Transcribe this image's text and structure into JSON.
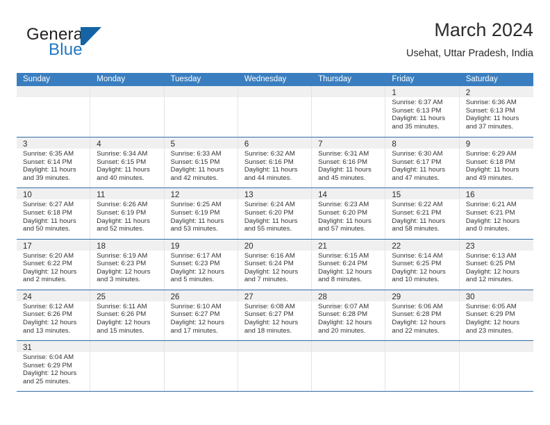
{
  "brand": {
    "name_part1": "General",
    "name_part2": "Blue",
    "mark_icon": "triangle-logo-icon",
    "color_primary": "#1464a5",
    "color_text": "#231f20"
  },
  "header": {
    "title": "March 2024",
    "subtitle": "Usehat, Uttar Pradesh, India"
  },
  "theme": {
    "header_blue": "#3a7ebf",
    "rule_blue": "#2f6ba5",
    "day_band_gray": "#f0f0f0"
  },
  "weekdays": [
    {
      "label": "Sunday"
    },
    {
      "label": "Monday"
    },
    {
      "label": "Tuesday"
    },
    {
      "label": "Wednesday"
    },
    {
      "label": "Thursday"
    },
    {
      "label": "Friday"
    },
    {
      "label": "Saturday"
    }
  ],
  "weeks": [
    {
      "days": [
        {
          "date": "",
          "empty": true,
          "lines": []
        },
        {
          "date": "",
          "empty": true,
          "lines": []
        },
        {
          "date": "",
          "empty": true,
          "lines": []
        },
        {
          "date": "",
          "empty": true,
          "lines": []
        },
        {
          "date": "",
          "empty": true,
          "lines": []
        },
        {
          "date": "1",
          "empty": false,
          "sunrise": "6:37 AM",
          "sunset": "6:13 PM",
          "daylight_hours": 11,
          "daylight_minutes": 35,
          "lines": [
            "Sunrise: 6:37 AM",
            "Sunset: 6:13 PM",
            "Daylight: 11 hours",
            "and 35 minutes."
          ]
        },
        {
          "date": "2",
          "empty": false,
          "sunrise": "6:36 AM",
          "sunset": "6:13 PM",
          "daylight_hours": 11,
          "daylight_minutes": 37,
          "lines": [
            "Sunrise: 6:36 AM",
            "Sunset: 6:13 PM",
            "Daylight: 11 hours",
            "and 37 minutes."
          ]
        }
      ]
    },
    {
      "days": [
        {
          "date": "3",
          "empty": false,
          "sunrise": "6:35 AM",
          "sunset": "6:14 PM",
          "daylight_hours": 11,
          "daylight_minutes": 39,
          "lines": [
            "Sunrise: 6:35 AM",
            "Sunset: 6:14 PM",
            "Daylight: 11 hours",
            "and 39 minutes."
          ]
        },
        {
          "date": "4",
          "empty": false,
          "sunrise": "6:34 AM",
          "sunset": "6:15 PM",
          "daylight_hours": 11,
          "daylight_minutes": 40,
          "lines": [
            "Sunrise: 6:34 AM",
            "Sunset: 6:15 PM",
            "Daylight: 11 hours",
            "and 40 minutes."
          ]
        },
        {
          "date": "5",
          "empty": false,
          "sunrise": "6:33 AM",
          "sunset": "6:15 PM",
          "daylight_hours": 11,
          "daylight_minutes": 42,
          "lines": [
            "Sunrise: 6:33 AM",
            "Sunset: 6:15 PM",
            "Daylight: 11 hours",
            "and 42 minutes."
          ]
        },
        {
          "date": "6",
          "empty": false,
          "sunrise": "6:32 AM",
          "sunset": "6:16 PM",
          "daylight_hours": 11,
          "daylight_minutes": 44,
          "lines": [
            "Sunrise: 6:32 AM",
            "Sunset: 6:16 PM",
            "Daylight: 11 hours",
            "and 44 minutes."
          ]
        },
        {
          "date": "7",
          "empty": false,
          "sunrise": "6:31 AM",
          "sunset": "6:16 PM",
          "daylight_hours": 11,
          "daylight_minutes": 45,
          "lines": [
            "Sunrise: 6:31 AM",
            "Sunset: 6:16 PM",
            "Daylight: 11 hours",
            "and 45 minutes."
          ]
        },
        {
          "date": "8",
          "empty": false,
          "sunrise": "6:30 AM",
          "sunset": "6:17 PM",
          "daylight_hours": 11,
          "daylight_minutes": 47,
          "lines": [
            "Sunrise: 6:30 AM",
            "Sunset: 6:17 PM",
            "Daylight: 11 hours",
            "and 47 minutes."
          ]
        },
        {
          "date": "9",
          "empty": false,
          "sunrise": "6:29 AM",
          "sunset": "6:18 PM",
          "daylight_hours": 11,
          "daylight_minutes": 49,
          "lines": [
            "Sunrise: 6:29 AM",
            "Sunset: 6:18 PM",
            "Daylight: 11 hours",
            "and 49 minutes."
          ]
        }
      ]
    },
    {
      "days": [
        {
          "date": "10",
          "empty": false,
          "sunrise": "6:27 AM",
          "sunset": "6:18 PM",
          "daylight_hours": 11,
          "daylight_minutes": 50,
          "lines": [
            "Sunrise: 6:27 AM",
            "Sunset: 6:18 PM",
            "Daylight: 11 hours",
            "and 50 minutes."
          ]
        },
        {
          "date": "11",
          "empty": false,
          "sunrise": "6:26 AM",
          "sunset": "6:19 PM",
          "daylight_hours": 11,
          "daylight_minutes": 52,
          "lines": [
            "Sunrise: 6:26 AM",
            "Sunset: 6:19 PM",
            "Daylight: 11 hours",
            "and 52 minutes."
          ]
        },
        {
          "date": "12",
          "empty": false,
          "sunrise": "6:25 AM",
          "sunset": "6:19 PM",
          "daylight_hours": 11,
          "daylight_minutes": 53,
          "lines": [
            "Sunrise: 6:25 AM",
            "Sunset: 6:19 PM",
            "Daylight: 11 hours",
            "and 53 minutes."
          ]
        },
        {
          "date": "13",
          "empty": false,
          "sunrise": "6:24 AM",
          "sunset": "6:20 PM",
          "daylight_hours": 11,
          "daylight_minutes": 55,
          "lines": [
            "Sunrise: 6:24 AM",
            "Sunset: 6:20 PM",
            "Daylight: 11 hours",
            "and 55 minutes."
          ]
        },
        {
          "date": "14",
          "empty": false,
          "sunrise": "6:23 AM",
          "sunset": "6:20 PM",
          "daylight_hours": 11,
          "daylight_minutes": 57,
          "lines": [
            "Sunrise: 6:23 AM",
            "Sunset: 6:20 PM",
            "Daylight: 11 hours",
            "and 57 minutes."
          ]
        },
        {
          "date": "15",
          "empty": false,
          "sunrise": "6:22 AM",
          "sunset": "6:21 PM",
          "daylight_hours": 11,
          "daylight_minutes": 58,
          "lines": [
            "Sunrise: 6:22 AM",
            "Sunset: 6:21 PM",
            "Daylight: 11 hours",
            "and 58 minutes."
          ]
        },
        {
          "date": "16",
          "empty": false,
          "sunrise": "6:21 AM",
          "sunset": "6:21 PM",
          "daylight_hours": 12,
          "daylight_minutes": 0,
          "lines": [
            "Sunrise: 6:21 AM",
            "Sunset: 6:21 PM",
            "Daylight: 12 hours",
            "and 0 minutes."
          ]
        }
      ]
    },
    {
      "days": [
        {
          "date": "17",
          "empty": false,
          "sunrise": "6:20 AM",
          "sunset": "6:22 PM",
          "daylight_hours": 12,
          "daylight_minutes": 2,
          "lines": [
            "Sunrise: 6:20 AM",
            "Sunset: 6:22 PM",
            "Daylight: 12 hours",
            "and 2 minutes."
          ]
        },
        {
          "date": "18",
          "empty": false,
          "sunrise": "6:19 AM",
          "sunset": "6:23 PM",
          "daylight_hours": 12,
          "daylight_minutes": 3,
          "lines": [
            "Sunrise: 6:19 AM",
            "Sunset: 6:23 PM",
            "Daylight: 12 hours",
            "and 3 minutes."
          ]
        },
        {
          "date": "19",
          "empty": false,
          "sunrise": "6:17 AM",
          "sunset": "6:23 PM",
          "daylight_hours": 12,
          "daylight_minutes": 5,
          "lines": [
            "Sunrise: 6:17 AM",
            "Sunset: 6:23 PM",
            "Daylight: 12 hours",
            "and 5 minutes."
          ]
        },
        {
          "date": "20",
          "empty": false,
          "sunrise": "6:16 AM",
          "sunset": "6:24 PM",
          "daylight_hours": 12,
          "daylight_minutes": 7,
          "lines": [
            "Sunrise: 6:16 AM",
            "Sunset: 6:24 PM",
            "Daylight: 12 hours",
            "and 7 minutes."
          ]
        },
        {
          "date": "21",
          "empty": false,
          "sunrise": "6:15 AM",
          "sunset": "6:24 PM",
          "daylight_hours": 12,
          "daylight_minutes": 8,
          "lines": [
            "Sunrise: 6:15 AM",
            "Sunset: 6:24 PM",
            "Daylight: 12 hours",
            "and 8 minutes."
          ]
        },
        {
          "date": "22",
          "empty": false,
          "sunrise": "6:14 AM",
          "sunset": "6:25 PM",
          "daylight_hours": 12,
          "daylight_minutes": 10,
          "lines": [
            "Sunrise: 6:14 AM",
            "Sunset: 6:25 PM",
            "Daylight: 12 hours",
            "and 10 minutes."
          ]
        },
        {
          "date": "23",
          "empty": false,
          "sunrise": "6:13 AM",
          "sunset": "6:25 PM",
          "daylight_hours": 12,
          "daylight_minutes": 12,
          "lines": [
            "Sunrise: 6:13 AM",
            "Sunset: 6:25 PM",
            "Daylight: 12 hours",
            "and 12 minutes."
          ]
        }
      ]
    },
    {
      "days": [
        {
          "date": "24",
          "empty": false,
          "sunrise": "6:12 AM",
          "sunset": "6:26 PM",
          "daylight_hours": 12,
          "daylight_minutes": 13,
          "lines": [
            "Sunrise: 6:12 AM",
            "Sunset: 6:26 PM",
            "Daylight: 12 hours",
            "and 13 minutes."
          ]
        },
        {
          "date": "25",
          "empty": false,
          "sunrise": "6:11 AM",
          "sunset": "6:26 PM",
          "daylight_hours": 12,
          "daylight_minutes": 15,
          "lines": [
            "Sunrise: 6:11 AM",
            "Sunset: 6:26 PM",
            "Daylight: 12 hours",
            "and 15 minutes."
          ]
        },
        {
          "date": "26",
          "empty": false,
          "sunrise": "6:10 AM",
          "sunset": "6:27 PM",
          "daylight_hours": 12,
          "daylight_minutes": 17,
          "lines": [
            "Sunrise: 6:10 AM",
            "Sunset: 6:27 PM",
            "Daylight: 12 hours",
            "and 17 minutes."
          ]
        },
        {
          "date": "27",
          "empty": false,
          "sunrise": "6:08 AM",
          "sunset": "6:27 PM",
          "daylight_hours": 12,
          "daylight_minutes": 18,
          "lines": [
            "Sunrise: 6:08 AM",
            "Sunset: 6:27 PM",
            "Daylight: 12 hours",
            "and 18 minutes."
          ]
        },
        {
          "date": "28",
          "empty": false,
          "sunrise": "6:07 AM",
          "sunset": "6:28 PM",
          "daylight_hours": 12,
          "daylight_minutes": 20,
          "lines": [
            "Sunrise: 6:07 AM",
            "Sunset: 6:28 PM",
            "Daylight: 12 hours",
            "and 20 minutes."
          ]
        },
        {
          "date": "29",
          "empty": false,
          "sunrise": "6:06 AM",
          "sunset": "6:28 PM",
          "daylight_hours": 12,
          "daylight_minutes": 22,
          "lines": [
            "Sunrise: 6:06 AM",
            "Sunset: 6:28 PM",
            "Daylight: 12 hours",
            "and 22 minutes."
          ]
        },
        {
          "date": "30",
          "empty": false,
          "sunrise": "6:05 AM",
          "sunset": "6:29 PM",
          "daylight_hours": 12,
          "daylight_minutes": 23,
          "lines": [
            "Sunrise: 6:05 AM",
            "Sunset: 6:29 PM",
            "Daylight: 12 hours",
            "and 23 minutes."
          ]
        }
      ]
    },
    {
      "days": [
        {
          "date": "31",
          "empty": false,
          "sunrise": "6:04 AM",
          "sunset": "6:29 PM",
          "daylight_hours": 12,
          "daylight_minutes": 25,
          "lines": [
            "Sunrise: 6:04 AM",
            "Sunset: 6:29 PM",
            "Daylight: 12 hours",
            "and 25 minutes."
          ]
        },
        {
          "date": "",
          "empty": true,
          "lines": []
        },
        {
          "date": "",
          "empty": true,
          "lines": []
        },
        {
          "date": "",
          "empty": true,
          "lines": []
        },
        {
          "date": "",
          "empty": true,
          "lines": []
        },
        {
          "date": "",
          "empty": true,
          "lines": []
        },
        {
          "date": "",
          "empty": true,
          "lines": []
        }
      ]
    }
  ]
}
